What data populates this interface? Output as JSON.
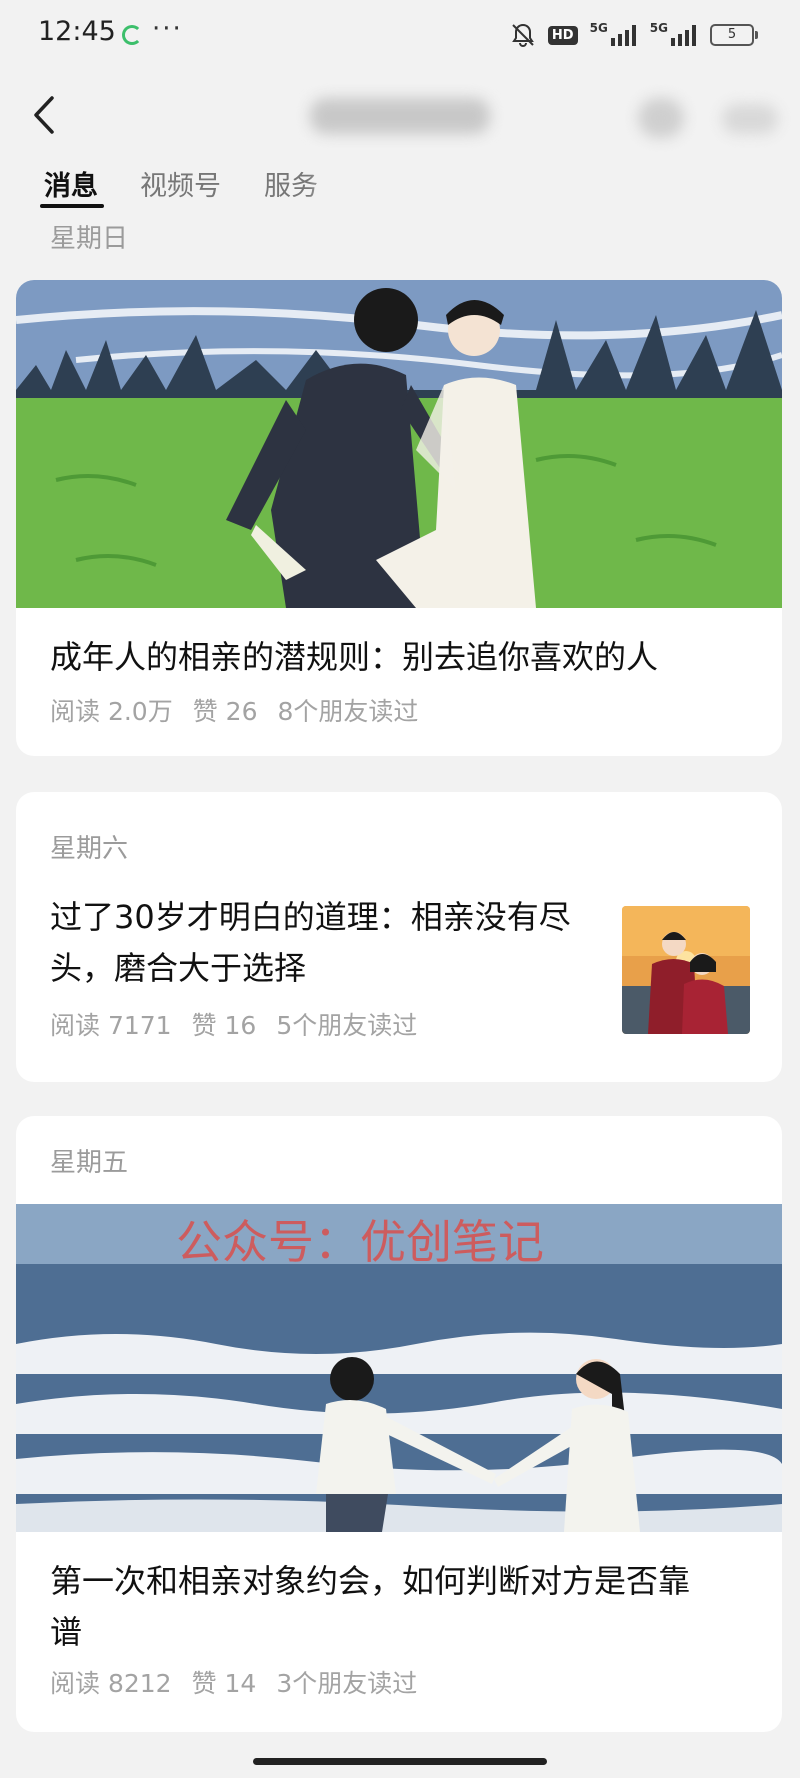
{
  "status_bar": {
    "time": "12:45",
    "more": "···",
    "hd": "HD",
    "net1": "5G",
    "net2": "5G",
    "battery": "5"
  },
  "tabs": [
    {
      "label": "消息"
    },
    {
      "label": "视频号"
    },
    {
      "label": "服务"
    }
  ],
  "articles": [
    {
      "day": "星期日",
      "title": "成年人的相亲的潜规则：别去追你喜欢的人",
      "reads": "阅读 2.0万",
      "likes": "赞 26",
      "friends": "8个朋友读过"
    },
    {
      "day": "星期六",
      "title_line1": "过了30岁才明白的道理：相亲没有尽",
      "title_line2": "头，磨合大于选择",
      "reads": "阅读 7171",
      "likes": "赞 16",
      "friends": "5个朋友读过"
    },
    {
      "day": "星期五",
      "watermark": "公众号：优创笔记",
      "title_line1": "第一次和相亲对象约会，如何判断对方是否靠",
      "title_line2": "谱",
      "reads": "阅读 8212",
      "likes": "赞 14",
      "friends": "3个朋友读过"
    }
  ],
  "colors": {
    "background": "#f2f2f2",
    "card": "#ffffff",
    "muted_text": "#a3a3a3",
    "watermark": "#d9504d",
    "grass": "#6fb84a",
    "sky": "#7d9ac2",
    "sea": "#4e6e93"
  }
}
